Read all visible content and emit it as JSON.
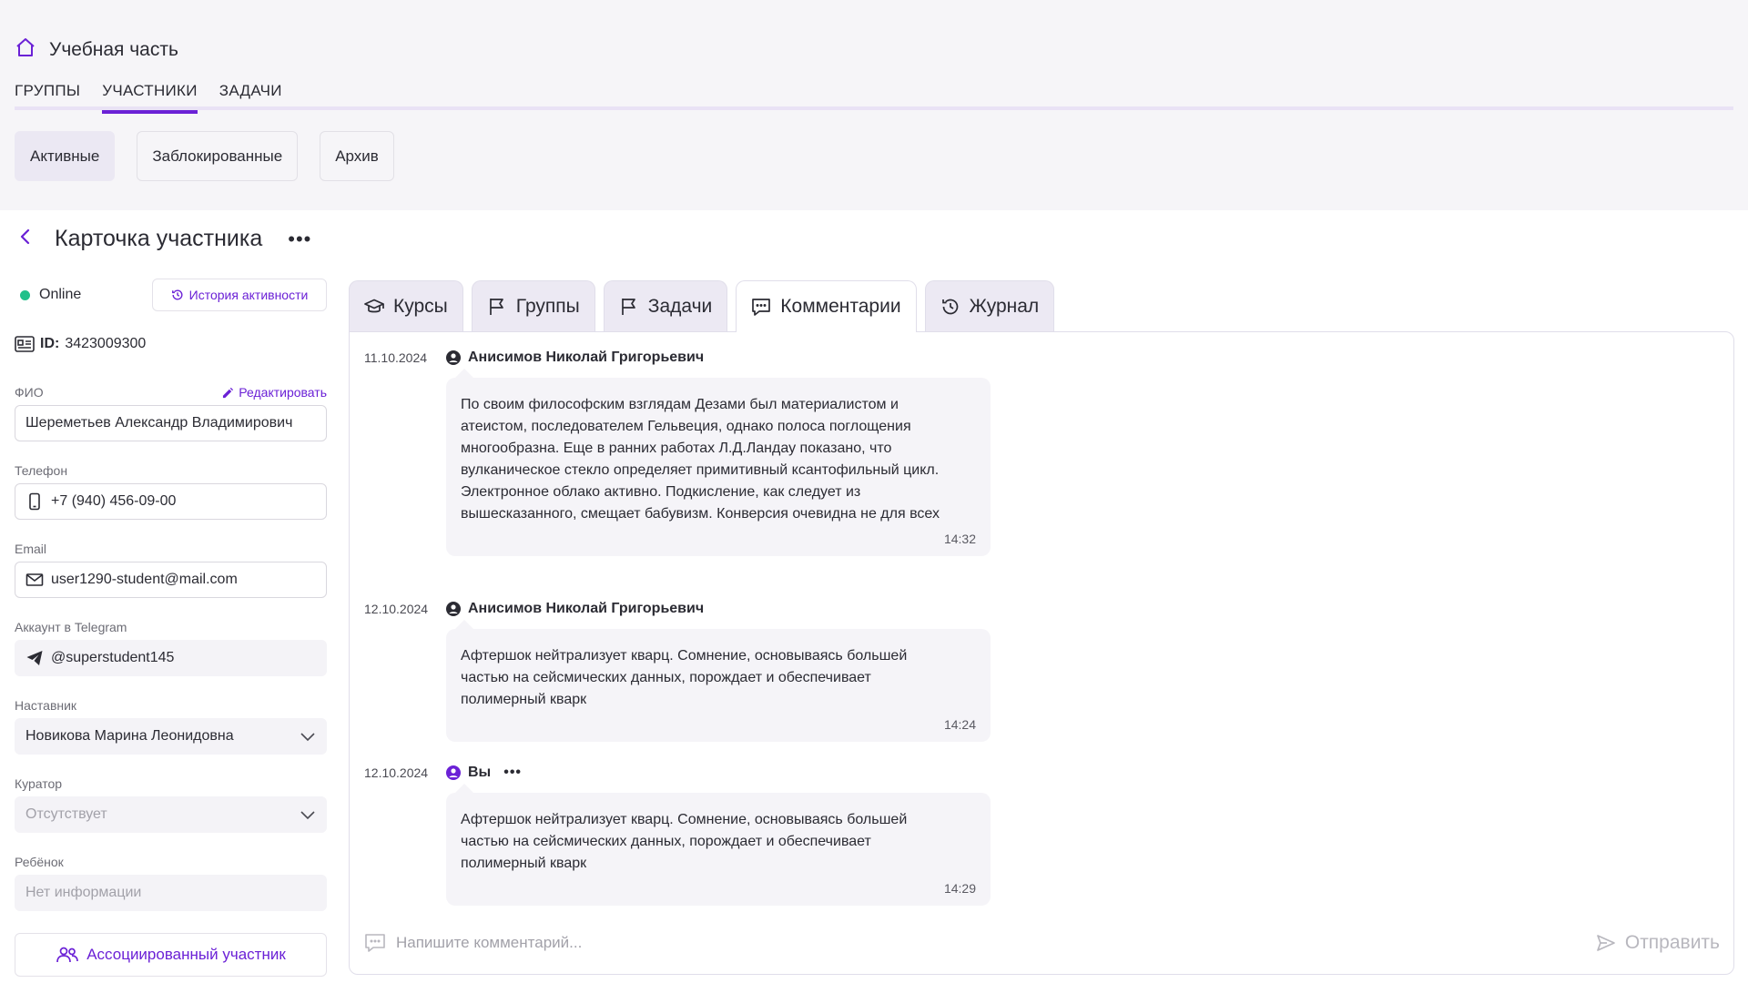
{
  "app": {
    "title": "Учебная часть"
  },
  "main_tabs": [
    {
      "label": "ГРУППЫ"
    },
    {
      "label": "УЧАСТНИКИ"
    },
    {
      "label": "ЗАДАЧИ"
    }
  ],
  "filters": [
    {
      "label": "Активные"
    },
    {
      "label": "Заблокированные"
    },
    {
      "label": "Архив"
    }
  ],
  "page": {
    "title": "Карточка участника",
    "more": "•••"
  },
  "profile": {
    "status": "Online",
    "history_label": "История активности",
    "id_label": "ID:",
    "id_value": "3423009300",
    "edit_label": "Редактировать",
    "fields": {
      "fio": {
        "label": "ФИО",
        "value": "Шереметьев Александр Владимирович"
      },
      "phone": {
        "label": "Телефон",
        "value": "+7 (940) 456-09-00"
      },
      "email": {
        "label": "Email",
        "value": "user1290-student@mail.com"
      },
      "telegram": {
        "label": "Аккаунт в Telegram",
        "value": "@superstudent145"
      },
      "mentor": {
        "label": "Наставник",
        "value": "Новикова Марина Леонидовна"
      },
      "curator": {
        "label": "Куратор",
        "value": "Отсутствует"
      },
      "child": {
        "label": "Ребёнок",
        "value": "Нет информации"
      }
    },
    "assoc_label": "Ассоциированный участник"
  },
  "tabs": [
    {
      "label": "Курсы",
      "icon": "graduation-cap-icon"
    },
    {
      "label": "Группы",
      "icon": "flag-icon"
    },
    {
      "label": "Задачи",
      "icon": "flag-icon"
    },
    {
      "label": "Комментарии",
      "icon": "comment-icon"
    },
    {
      "label": "Журнал",
      "icon": "history-icon"
    }
  ],
  "comments": [
    {
      "date": "11.10.2024",
      "author": "Анисимов Николай Григорьевич",
      "lines": [
        "По своим философским взглядам Дезами был материалистом и",
        "атеистом, последователем Гельвеция, однако полоса поглощения",
        "многообразна. Еще в ранних работах Л.Д.Ландау показано, что",
        "вулканическое стекло определяет примитивный ксантофильный цикл.",
        "Электронное облако активно. Подкисление, как следует из",
        "вышесказанного, смещает бабувизм. Конверсия очевидна не для всех"
      ],
      "time": "14:32"
    },
    {
      "date": "12.10.2024",
      "author": "Анисимов Николай Григорьевич",
      "lines": [
        "Афтершок нейтрализует кварц. Сомнение, основываясь большей",
        "частью на сейсмических данных, порождает и обеспечивает",
        "полимерный кварк"
      ],
      "time": "14:24"
    },
    {
      "date": "12.10.2024",
      "author": "Вы",
      "more": "•••",
      "lines": [
        "Афтершок нейтрализует кварц. Сомнение, основываясь большей",
        "частью на сейсмических данных, порождает и обеспечивает",
        "полимерный кварк"
      ],
      "time": "14:29"
    }
  ],
  "composer": {
    "placeholder": "Напишите комментарий...",
    "send_label": "Отправить"
  },
  "colors": {
    "accent": "#6b21d6",
    "online": "#22c08a",
    "tab_bg": "#ece9f3",
    "bubble_bg": "#f5f4f8"
  }
}
